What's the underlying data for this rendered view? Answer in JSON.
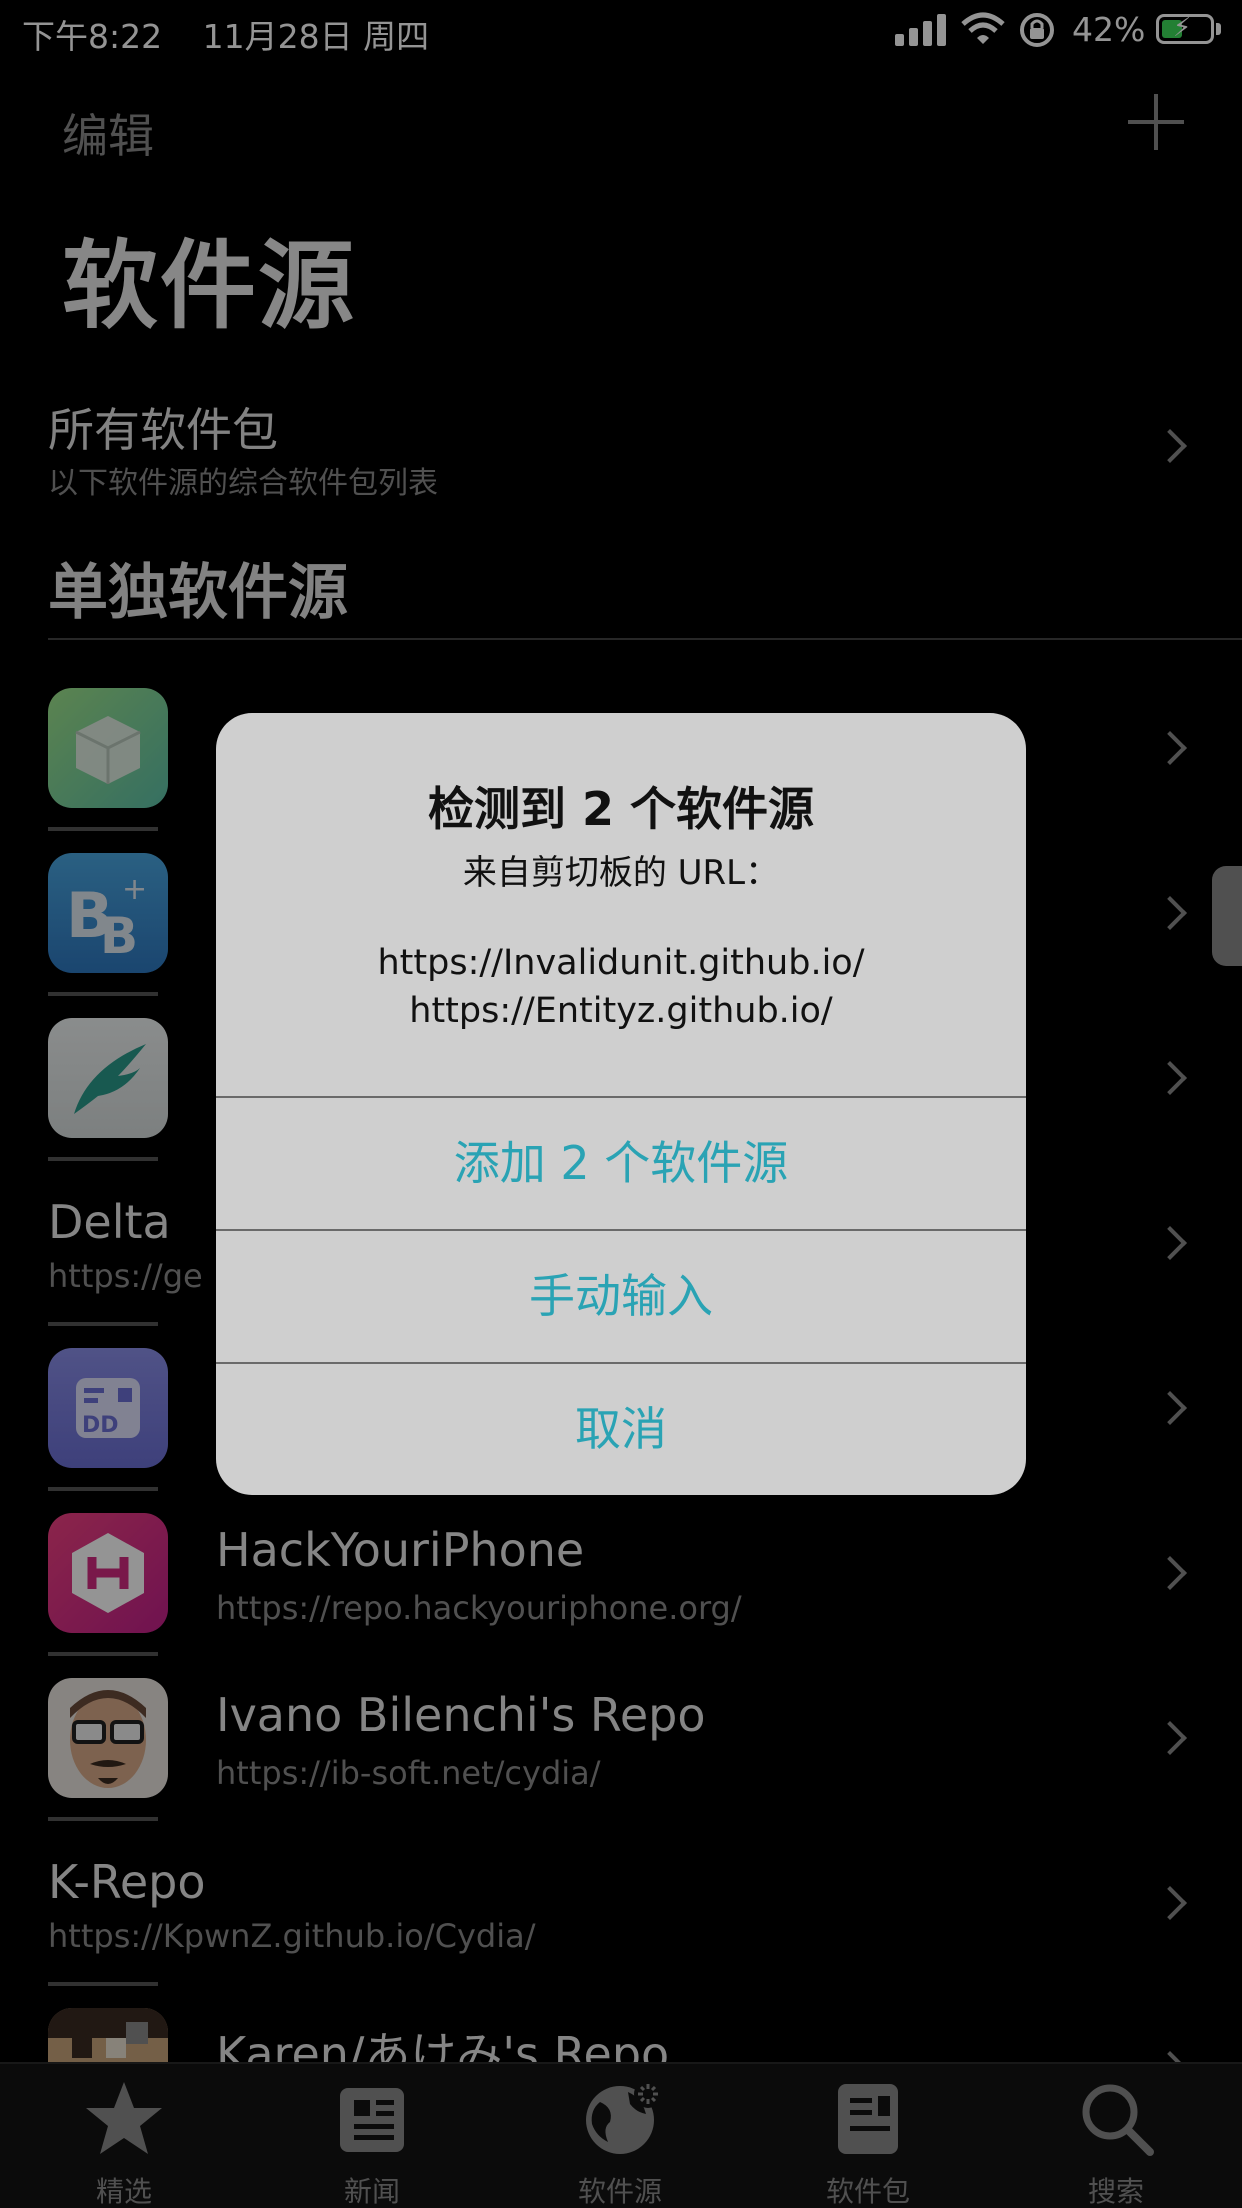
{
  "status_bar": {
    "time": "下午8:22",
    "date": "11月28日 周四",
    "battery": "42%"
  },
  "nav": {
    "edit_label": "编辑",
    "title": "软件源"
  },
  "all_packages": {
    "title": "所有软件包",
    "subtitle": "以下软件源的综合软件包列表"
  },
  "section_title": "单独软件源",
  "sources": [
    {
      "name": "",
      "url": "",
      "icon": "package-box-icon"
    },
    {
      "name": "",
      "url": "",
      "icon": "bigboss-icon"
    },
    {
      "name": "",
      "url": "",
      "icon": "wing-icon"
    },
    {
      "name": "Delta",
      "url": "https://ge",
      "icon": ""
    },
    {
      "name": "",
      "url": "",
      "icon": "dd-icon"
    },
    {
      "name": "HackYouriPhone",
      "url": "https://repo.hackyouriphone.org/",
      "icon": "hackyouriphone-icon"
    },
    {
      "name": "Ivano Bilenchi's Repo",
      "url": "https://ib-soft.net/cydia/",
      "icon": "avatar-glasses-icon"
    },
    {
      "name": "K-Repo",
      "url": "https://KpwnZ.github.io/Cydia/",
      "icon": ""
    },
    {
      "name": "Karen/あけみ's Repo",
      "url": "",
      "icon": "pixel-avatar-icon"
    }
  ],
  "alert": {
    "title": "检测到 2 个软件源",
    "subtitle": "来自剪切板的 URL：",
    "urls": [
      "https://Invalidunit.github.io/",
      "https://Entityz.github.io/"
    ],
    "buttons": [
      "添加 2 个软件源",
      "手动输入",
      "取消"
    ],
    "accent_color": "#2aa3b4"
  },
  "tabs": [
    {
      "label": "精选",
      "icon": "star-icon"
    },
    {
      "label": "新闻",
      "icon": "newspaper-icon"
    },
    {
      "label": "软件源",
      "icon": "globe-icon"
    },
    {
      "label": "软件包",
      "icon": "package-icon"
    },
    {
      "label": "搜索",
      "icon": "search-icon"
    }
  ]
}
